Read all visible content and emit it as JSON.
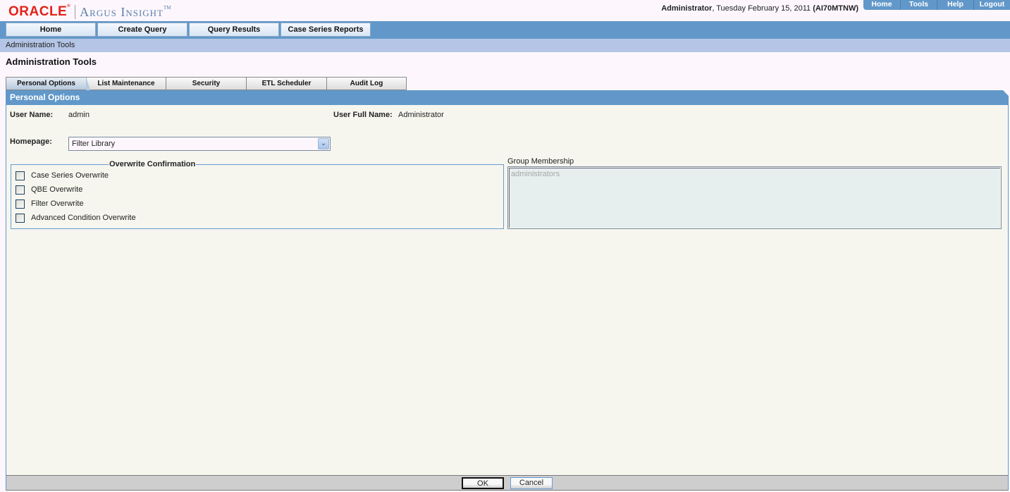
{
  "brand": {
    "company": "ORACLE",
    "product": "Argus Insight",
    "trademark": "TM"
  },
  "user_info": {
    "user": "Administrator",
    "date": "Tuesday February 15, 2011",
    "machine": "(AI70MTNW)"
  },
  "top_links": [
    {
      "label": "Home"
    },
    {
      "label": "Tools"
    },
    {
      "label": "Help"
    },
    {
      "label": "Logout"
    }
  ],
  "main_nav": [
    {
      "label": "Home"
    },
    {
      "label": "Create Query"
    },
    {
      "label": "Query Results"
    },
    {
      "label": "Case Series Reports"
    }
  ],
  "breadcrumb": "Administration Tools",
  "page_title": "Administration Tools",
  "tabs": [
    {
      "label": "Personal Options",
      "active": true
    },
    {
      "label": "List Maintenance"
    },
    {
      "label": "Security"
    },
    {
      "label": "ETL Scheduler"
    },
    {
      "label": "Audit Log"
    }
  ],
  "panel": {
    "title": "Personal Options",
    "user_name_label": "User Name:",
    "user_name": "admin",
    "user_full_name_label": "User Full Name:",
    "user_full_name": "Administrator",
    "homepage_label": "Homepage:",
    "homepage_value": "Filter Library",
    "overwrite": {
      "legend": "Overwrite Confirmation",
      "options": [
        {
          "label": "Case Series Overwrite",
          "checked": false
        },
        {
          "label": "QBE Overwrite",
          "checked": false
        },
        {
          "label": "Filter Overwrite",
          "checked": false
        },
        {
          "label": "Advanced Condition Overwrite",
          "checked": false
        }
      ]
    },
    "group_membership_label": "Group Membership",
    "group_membership": [
      "administrators"
    ]
  },
  "footer": {
    "ok_label": "OK",
    "cancel_label": "Cancel"
  },
  "colors": {
    "accent": "#6298c9",
    "breadcrumb_bg": "#b4c5e5",
    "panel_bg": "#f6f6ef",
    "oracle_red": "#e2231a"
  }
}
